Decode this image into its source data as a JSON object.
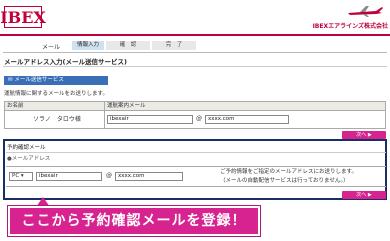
{
  "header": {
    "logo_text": "IBEX",
    "company_name": "IBEXエアラインズ株式会社",
    "brand_color": "#c0003a",
    "plane_icon": "airplane-icon"
  },
  "steps": {
    "label": "メール",
    "items": [
      "情報入力",
      "確　認",
      "完　了"
    ],
    "active_index": 0
  },
  "page_title": "メールアドレス入力(メール送信サービス)",
  "service": {
    "tab_label": "メール送信サービス",
    "tab_icon": "mail-icon",
    "description": "運航情報に関するメールをお送りします。",
    "table_headers": [
      "お名前",
      "運航案内メール"
    ],
    "name_value": "ソラノ　タロウ様",
    "email_local": "ibexair",
    "at_sign": "@",
    "email_domain": "xxxx.com",
    "next_label": "次へ"
  },
  "reservation": {
    "title": "予約確認メール",
    "sub_label": "●メールアドレス",
    "device_select": "PC",
    "email_local": "ibexair",
    "at_sign": "@",
    "email_domain": "xxxx.com",
    "note_line1": "ご予約情報をご指定のメールアドレスにお送りします。",
    "note_line2": "（メールの自動配信サービスは行っておりません。）",
    "next_label": "次へ",
    "box_color": "#1a2e63"
  },
  "banner": {
    "text": "ここから予約確認メールを登録！",
    "color": "#d6238f"
  }
}
